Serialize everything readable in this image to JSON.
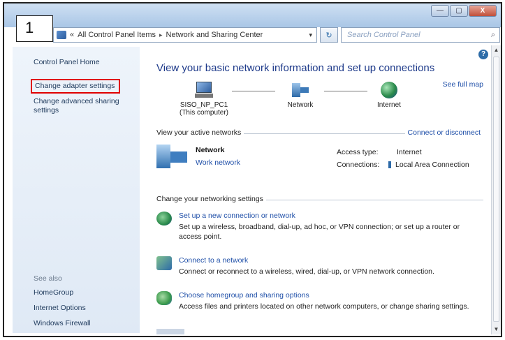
{
  "step_number": "1",
  "window": {
    "controls": {
      "minimize": "—",
      "maximize": "▢",
      "close": "X"
    }
  },
  "address": {
    "chevrons": "«",
    "crumb_1": "All Control Panel Items",
    "separator": "▸",
    "crumb_2": "Network and Sharing Center",
    "dropdown": "▾",
    "refresh": "↻",
    "search_placeholder": "Search Control Panel",
    "search_icon": "⌕"
  },
  "sidebar": {
    "home": "Control Panel Home",
    "adapter": "Change adapter settings",
    "advanced": "Change advanced sharing settings",
    "see_also": "See also",
    "homegroup": "HomeGroup",
    "internet_options": "Internet Options",
    "firewall": "Windows Firewall"
  },
  "main": {
    "heading": "View your basic network information and set up connections",
    "see_full_map": "See full map",
    "help": "?",
    "map": {
      "computer_name": "SISO_NP_PC1",
      "computer_sub": "(This computer)",
      "network": "Network",
      "internet": "Internet"
    },
    "active_networks": {
      "label": "View your active networks",
      "connect_link": "Connect or disconnect",
      "name": "Network",
      "type": "Work network",
      "access_type_label": "Access type:",
      "access_type_value": "Internet",
      "connections_label": "Connections:",
      "connections_value": "Local Area Connection"
    },
    "settings": {
      "label": "Change your networking settings",
      "tasks": [
        {
          "title": "Set up a new connection or network",
          "desc": "Set up a wireless, broadband, dial-up, ad hoc, or VPN connection; or set up a router or access point."
        },
        {
          "title": "Connect to a network",
          "desc": "Connect or reconnect to a wireless, wired, dial-up, or VPN network connection."
        },
        {
          "title": "Choose homegroup and sharing options",
          "desc": "Access files and printers located on other network computers, or change sharing settings."
        }
      ]
    }
  },
  "scrollbar": {
    "up": "▲",
    "down": "▼"
  },
  "icons": [
    "control-panel-icon",
    "computer-icon",
    "network-bench-icon",
    "globe-icon",
    "network-large-icon",
    "connection-icon",
    "setup-connection-icon",
    "connect-network-icon",
    "homegroup-icon",
    "help-icon",
    "search-icon",
    "refresh-icon"
  ]
}
